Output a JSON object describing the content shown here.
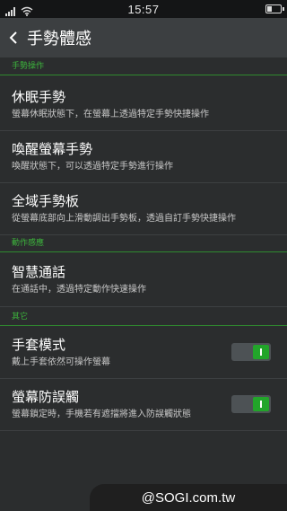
{
  "status_bar": {
    "time": "15:57"
  },
  "header": {
    "title": "手勢體感"
  },
  "sections": [
    {
      "header": "手勢操作"
    },
    {
      "header": "動作感應"
    },
    {
      "header": "其它"
    }
  ],
  "items": [
    {
      "title": "休眠手勢",
      "desc": "螢幕休眠狀態下，在螢幕上透過特定手勢快捷操作"
    },
    {
      "title": "喚醒螢幕手勢",
      "desc": "喚醒狀態下，可以透過特定手勢進行操作"
    },
    {
      "title": "全域手勢板",
      "desc": "從螢幕底部向上滑動調出手勢板，透過自訂手勢快捷操作"
    },
    {
      "title": "智慧通話",
      "desc": "在通話中，透過特定動作快速操作"
    },
    {
      "title": "手套模式",
      "desc": "戴上手套依然可操作螢幕",
      "toggle": true
    },
    {
      "title": "螢幕防誤觸",
      "desc": "螢幕鎖定時，手機若有遮擋將進入防誤觸狀態",
      "toggle": true
    }
  ],
  "watermark": "@SOGI.com.tw",
  "colors": {
    "accent": "#3cb33c",
    "toggle_on": "#22a52a",
    "background": "#2b2d2e",
    "header": "#3c3f41"
  },
  "icons": [
    "signal-icon",
    "wifi-icon",
    "battery-icon",
    "back-arrow-icon"
  ]
}
